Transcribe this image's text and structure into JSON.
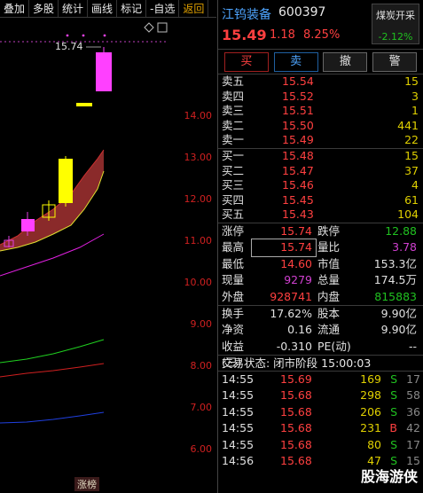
{
  "toolbar": {
    "items": [
      "叠加",
      "多股",
      "统计",
      "画线",
      "标记",
      "-自选",
      "返回"
    ]
  },
  "chart": {
    "peak_label": "15.74",
    "price_axis": [
      "14.00",
      "13.00",
      "12.00",
      "11.00",
      "10.00",
      "9.00",
      "8.00",
      "7.00",
      "6.00"
    ],
    "bottom_tag": "涨榜",
    "colors": {
      "up": "#ff40ff",
      "yellow": "#ffff00",
      "band_fill": "#8a2a2a",
      "ma_magenta": "#e020e0",
      "ma_green": "#20d020",
      "ma_red": "#d02020",
      "ma_blue": "#2040e0"
    }
  },
  "stock": {
    "name": "江钨装备",
    "code": "600397",
    "price": "15.49",
    "change": "1.18",
    "change_pct": "8.25%",
    "sector_name": "煤炭开采",
    "sector_pct": "-2.12%"
  },
  "actions": {
    "buy": "买",
    "sell": "卖",
    "cancel": "撤",
    "alert": "警"
  },
  "asks": [
    {
      "label": "卖五",
      "price": "15.54",
      "vol": "15"
    },
    {
      "label": "卖四",
      "price": "15.52",
      "vol": "3"
    },
    {
      "label": "卖三",
      "price": "15.51",
      "vol": "1"
    },
    {
      "label": "卖二",
      "price": "15.50",
      "vol": "441"
    },
    {
      "label": "卖一",
      "price": "15.49",
      "vol": "22"
    }
  ],
  "bids": [
    {
      "label": "买一",
      "price": "15.48",
      "vol": "15"
    },
    {
      "label": "买二",
      "price": "15.47",
      "vol": "37"
    },
    {
      "label": "买三",
      "price": "15.46",
      "vol": "4"
    },
    {
      "label": "买四",
      "price": "15.45",
      "vol": "61"
    },
    {
      "label": "买五",
      "price": "15.43",
      "vol": "104"
    }
  ],
  "stats1": [
    {
      "l1": "涨停",
      "v1": "15.74",
      "c1": "red",
      "l2": "跌停",
      "v2": "12.88",
      "c2": "green"
    },
    {
      "l1": "最高",
      "v1": "15.74",
      "c1": "red",
      "l2": "量比",
      "v2": "3.78",
      "c2": "purple"
    },
    {
      "l1": "最低",
      "v1": "14.60",
      "c1": "red",
      "l2": "市值",
      "v2": "153.3亿",
      "c2": "white"
    },
    {
      "l1": "现量",
      "v1": "9279",
      "c1": "purple",
      "l2": "总量",
      "v2": "174.5万",
      "c2": "white"
    },
    {
      "l1": "外盘",
      "v1": "928741",
      "c1": "red",
      "l2": "内盘",
      "v2": "815883",
      "c2": "green"
    }
  ],
  "stats2": [
    {
      "l1": "换手",
      "v1": "17.62%",
      "l2": "股本",
      "v2": "9.90亿"
    },
    {
      "l1": "净资",
      "v1": "0.16",
      "l2": "流通",
      "v2": "9.90亿"
    },
    {
      "l1": "收益(三)",
      "v1": "-0.310",
      "l2": "PE(动)",
      "v2": "--"
    }
  ],
  "trade_status": "交易状态: 闭市阶段 15:00:03",
  "trades": [
    {
      "time": "14:55",
      "price": "15.69",
      "vol": "169",
      "side": "S",
      "count": "17"
    },
    {
      "time": "14:55",
      "price": "15.68",
      "vol": "298",
      "side": "S",
      "count": "58"
    },
    {
      "time": "14:55",
      "price": "15.68",
      "vol": "206",
      "side": "S",
      "count": "36"
    },
    {
      "time": "14:55",
      "price": "15.68",
      "vol": "231",
      "side": "B",
      "count": "42"
    },
    {
      "time": "14:55",
      "price": "15.68",
      "vol": "80",
      "side": "S",
      "count": "17"
    },
    {
      "time": "14:56",
      "price": "15.68",
      "vol": "47",
      "side": "S",
      "count": "15"
    }
  ],
  "watermark": "股海游侠"
}
